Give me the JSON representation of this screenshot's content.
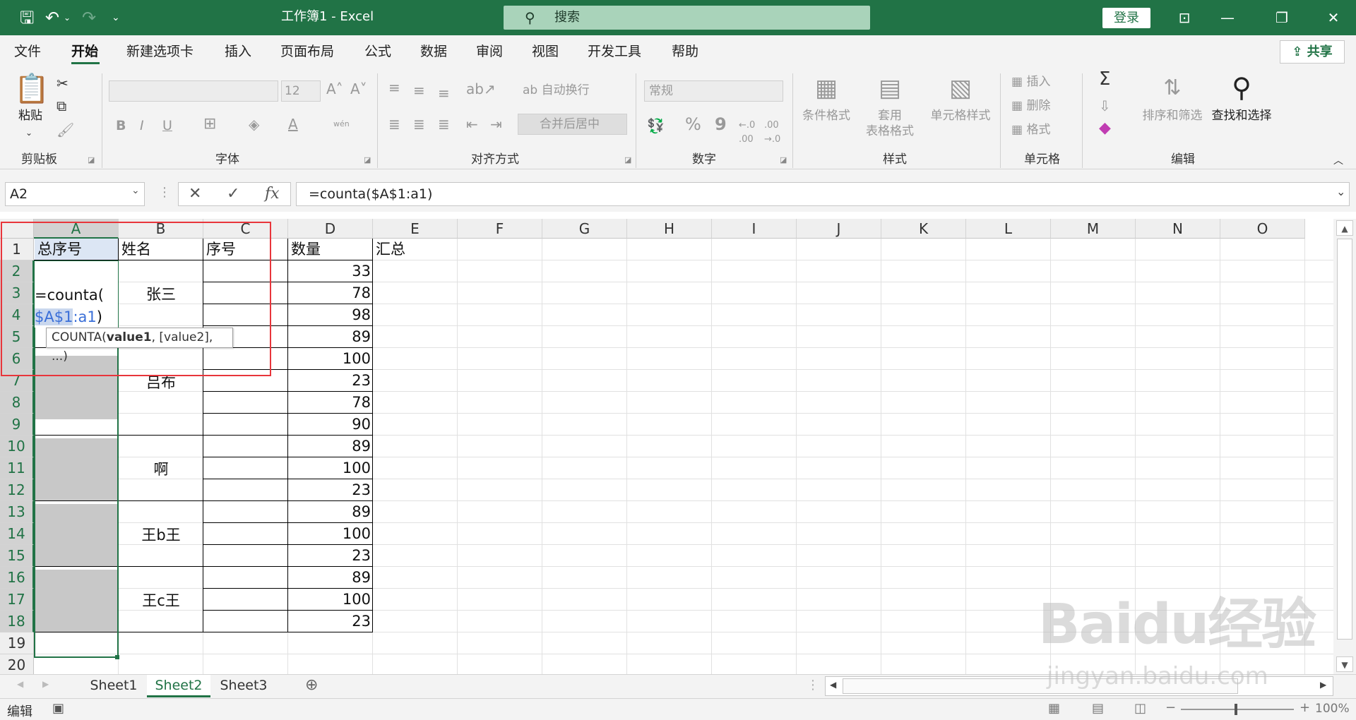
{
  "titlebar": {
    "title": "工作簿1  -  Excel",
    "search_placeholder": "搜索",
    "login": "登录",
    "save_icon": "save-icon",
    "undo_icon": "undo-icon",
    "redo_icon": "redo-icon"
  },
  "menu": {
    "tabs": [
      "文件",
      "开始",
      "新建选项卡",
      "插入",
      "页面布局",
      "公式",
      "数据",
      "审阅",
      "视图",
      "开发工具",
      "帮助"
    ],
    "active": "开始",
    "share": "共享"
  },
  "ribbon": {
    "clipboard": {
      "label": "剪贴板",
      "paste": "粘贴"
    },
    "font": {
      "label": "字体",
      "font_size": "12",
      "bold": "B",
      "italic": "I",
      "underline": "U",
      "font_color": "A",
      "phonetic": "wén"
    },
    "alignment": {
      "label": "对齐方式",
      "wrap": "自动换行",
      "merge": "合并后居中"
    },
    "number": {
      "label": "数字",
      "format": "常规",
      "percent": "%",
      "comma": "9"
    },
    "styles": {
      "label": "样式",
      "cond": "条件格式",
      "table": "套用",
      "table2": "表格格式",
      "cell": "单元格样式"
    },
    "cells": {
      "label": "单元格",
      "insert": "插入",
      "delete": "删除",
      "format": "格式"
    },
    "editing": {
      "label": "编辑",
      "sort": "排序和筛选",
      "find": "查找和选择",
      "sum": "Σ"
    }
  },
  "formula_bar": {
    "name_box": "A2",
    "formula": "=counta($A$1:a1)",
    "fx": "fx"
  },
  "columns": [
    "A",
    "B",
    "C",
    "D",
    "E",
    "F",
    "G",
    "H",
    "I",
    "J",
    "K",
    "L",
    "M",
    "N",
    "O"
  ],
  "rows": [
    "1",
    "2",
    "3",
    "4",
    "5",
    "6",
    "7",
    "8",
    "9",
    "10",
    "11",
    "12",
    "13",
    "14",
    "15",
    "16",
    "17",
    "18",
    "19",
    "20"
  ],
  "headers": {
    "a1": "总序号",
    "b1": "姓名",
    "c1": "序号",
    "d1": "数量",
    "e1": "汇总"
  },
  "names": [
    "张三",
    "吕布",
    "啊",
    "王b王",
    "王c王"
  ],
  "quantities": [
    "33",
    "78",
    "98",
    "89",
    "100",
    "23",
    "78",
    "90",
    "89",
    "100",
    "23",
    "89",
    "100",
    "23",
    "89",
    "100",
    "23"
  ],
  "editing_cell": {
    "line1": "=counta(",
    "ref_abs": "$A$1",
    "ref_rel": ":a1",
    "close": ")"
  },
  "tooltip": {
    "prefix": "COUNTA(",
    "arg1": "value1",
    "rest": ", [value2], ...)"
  },
  "sheets": [
    "Sheet1",
    "Sheet2",
    "Sheet3"
  ],
  "active_sheet": "Sheet2",
  "status": {
    "mode": "编辑",
    "zoom": "100%"
  },
  "watermark": {
    "brand": "Baidu经验",
    "url": "jingyan.baidu.com"
  },
  "colors": {
    "excel_green": "#217346",
    "highlight_red": "#e8353b",
    "ref_blue": "#3a6fd8"
  }
}
